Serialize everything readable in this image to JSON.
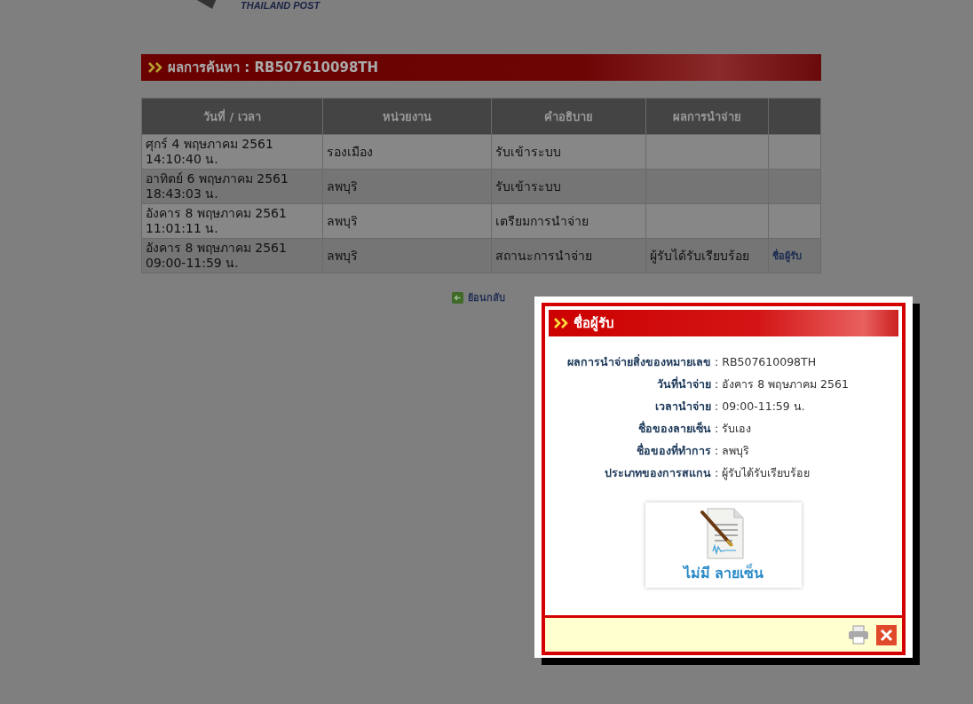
{
  "header": {
    "logo_text": "THAILAND POST"
  },
  "result_bar": {
    "title": "ผลการค้นหา : RB507610098TH"
  },
  "table": {
    "columns": [
      "วันที่ / เวลา",
      "หน่วยงาน",
      "คำอธิบาย",
      "ผลการนำจ่าย"
    ],
    "rows": [
      {
        "datetime": "ศุกร์ 4 พฤษภาคม 2561\n14:10:40 น.",
        "office": "รองเมือง",
        "description": "รับเข้าระบบ"
      },
      {
        "datetime": "อาทิตย์ 6 พฤษภาคม 2561\n18:43:03 น.",
        "office": "ลพบุริ",
        "description": "รับเข้าระบบ"
      },
      {
        "datetime": "อังคาร 8 พฤษภาคม 2561\n11:01:11 น.",
        "office": "ลพบุริ",
        "description": "เตรียมการนำจ่าย"
      },
      {
        "datetime": "อังคาร 8 พฤษภาคม 2561\n09:00-11:59 น.",
        "office": "ลพบุริ",
        "description": "สถานะการนำจ่าย",
        "result": "ผู้รับได้รับเรียบร้อย",
        "link": "ชื่อผู้รับ"
      }
    ]
  },
  "back_link": "ย้อนกลับ",
  "dialog": {
    "title": "ชื่อผู้รับ",
    "fields": [
      {
        "label": "ผลการนำจ่ายสิ่งของหมายเลข",
        "value": "RB507610098TH"
      },
      {
        "label": "วันที่นำจ่าย",
        "value": "อังคาร 8 พฤษภาคม 2561"
      },
      {
        "label": "เวลานำจ่าย",
        "value": "09:00-11:59 น."
      },
      {
        "label": "ชื่อของลายเซ็น",
        "value": "รับเอง"
      },
      {
        "label": "ชื่อของที่ทำการ",
        "value": "ลพบุริ"
      },
      {
        "label": "ประเภทของการสแกน",
        "value": "ผู้รับได้รับเรียบร้อย"
      }
    ],
    "separator": ":",
    "signature_caption": "ไม่มี ลายเซ็น"
  }
}
